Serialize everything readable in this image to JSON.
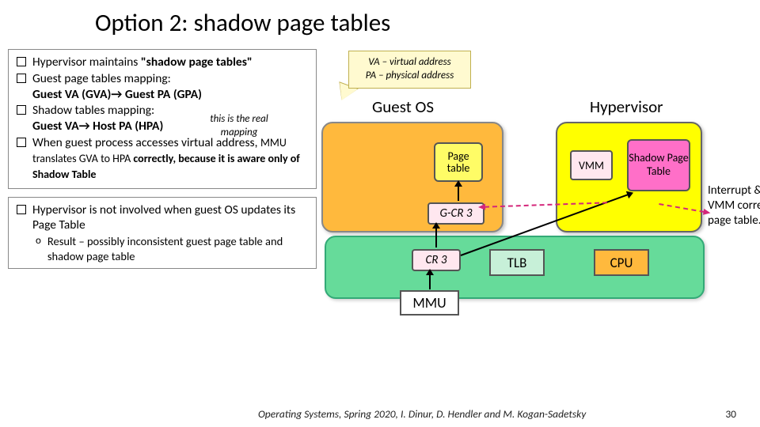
{
  "title": "Option 2: shadow page tables",
  "bullets_a": {
    "b1": "Hypervisor maintains ",
    "b1b": "\"shadow page tables\"",
    "b2": "Guest page tables mapping:",
    "b2l": "Guest VA (GVA)→ Guest PA (GPA)",
    "b3": "Shadow tables mapping:",
    "b3l": "Guest VA→ Host PA (HPA)",
    "note": "this is the real mapping",
    "b4": "When guest process accesses virtual address, ",
    "b4m": "MMU translates GVA to HPA ",
    "b4t": "correctly, because it is aware only of Shadow Table"
  },
  "bullets_b": {
    "b1": "Hypervisor is not involved when guest OS updates its Page Table",
    "s1": "Result – possibly inconsistent guest page table and shadow page table"
  },
  "legend": {
    "l1": "VA – virtual address",
    "l2": "PA – physical address"
  },
  "diagram": {
    "guest_os": "Guest OS",
    "hypervisor": "Hypervisor",
    "page_table": "Page table",
    "gcr3": "G-CR 3",
    "vmm": "VMM",
    "spt": "Shadow Page Table",
    "cr3": "CR 3",
    "tlb": "TLB",
    "cpu": "CPU",
    "mmu": "MMU",
    "side": "Interrupt & VMM corrects page table."
  },
  "footer": {
    "course": "Operating Systems, Spring 2020, I. Dinur, D. Hendler and M. Kogan-Sadetsky",
    "page": "30"
  }
}
